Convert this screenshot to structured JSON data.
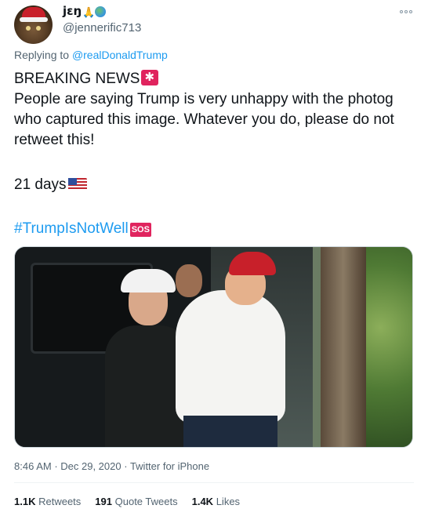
{
  "author": {
    "display_name": "jɛŋ",
    "name_emojis": [
      "folded-hands-emoji",
      "globe-emoji"
    ],
    "handle": "@jennerific713"
  },
  "reply": {
    "prefix": "Replying to",
    "mention": "@realDonaldTrump"
  },
  "tweet": {
    "line1": "BREAKING NEWS",
    "line2": "People are saying Trump is very unhappy with the photog",
    "line3": "who captured this image. Whatever you do, please do not",
    "line4": "retweet this!",
    "line5": "21 days",
    "hashtag": "#TrumpIsNotWell",
    "sos_label": "SOS"
  },
  "meta": {
    "time": "8:46 AM",
    "separator": " · ",
    "date": "Dec 29, 2020",
    "source": "Twitter for iPhone"
  },
  "stats": {
    "retweets_count": "1.1K",
    "retweets_label": "Retweets",
    "quotes_count": "191",
    "quotes_label": "Quote Tweets",
    "likes_count": "1.4K",
    "likes_label": "Likes"
  },
  "colors": {
    "link": "#1d9bf0",
    "muted": "#536471",
    "text": "#0f1419"
  }
}
